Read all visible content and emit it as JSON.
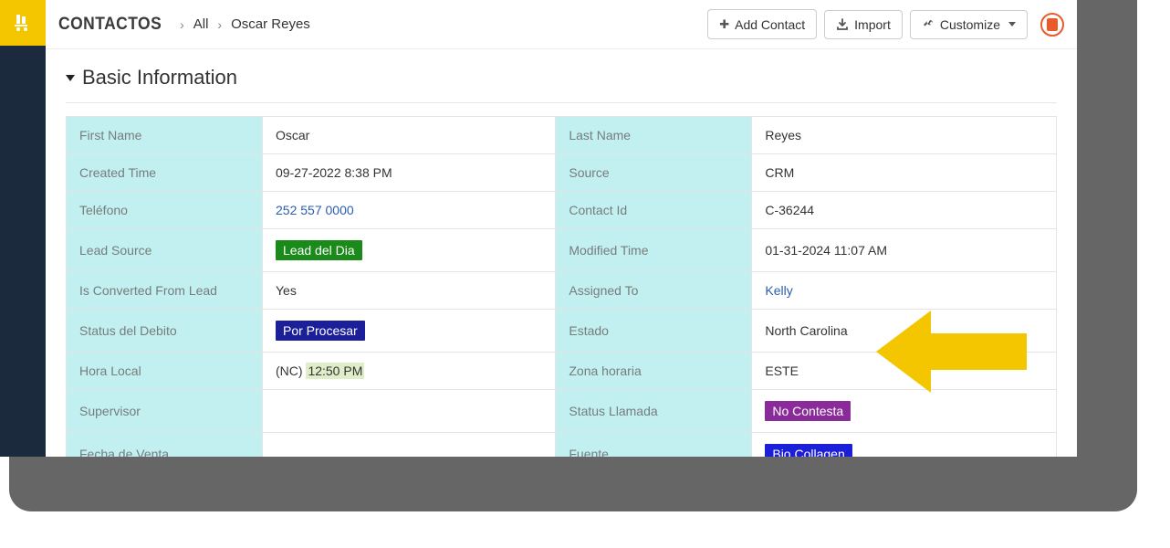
{
  "header": {
    "brand": "CONTACTOS",
    "crumb_all": "All",
    "crumb_current": "Oscar Reyes",
    "add_contact": "Add Contact",
    "import": "Import",
    "customize": "Customize"
  },
  "section": {
    "title": "Basic Information"
  },
  "fields": {
    "first_name_label": "First Name",
    "first_name": "Oscar",
    "last_name_label": "Last Name",
    "last_name": "Reyes",
    "created_time_label": "Created Time",
    "created_time": "09-27-2022 8:38 PM",
    "source_label": "Source",
    "source": "CRM",
    "telefono_label": "Teléfono",
    "telefono": "252 557 0000",
    "contact_id_label": "Contact Id",
    "contact_id": "C-36244",
    "lead_source_label": "Lead Source",
    "lead_source_tag": "Lead del Dia",
    "modified_time_label": "Modified Time",
    "modified_time": "01-31-2024 11:07 AM",
    "is_converted_label": "Is Converted From Lead",
    "is_converted": "Yes",
    "assigned_to_label": "Assigned To",
    "assigned_to": "Kelly",
    "status_debito_label": "Status del Debito",
    "status_debito_tag": "Por Procesar",
    "estado_label": "Estado",
    "estado": "North Carolina",
    "hora_local_label": "Hora Local",
    "hora_local_prefix": "(NC) ",
    "hora_local_time": "12:50 PM",
    "zona_horaria_label": "Zona horaria",
    "zona_horaria": "ESTE",
    "supervisor_label": "Supervisor",
    "supervisor": "",
    "status_llamada_label": "Status Llamada",
    "status_llamada_tag": "No Contesta",
    "fecha_venta_label": "Fecha de Venta",
    "fecha_venta": "",
    "fuente_label": "Fuente",
    "fuente_tag": "Bio Collagen"
  },
  "colors": {
    "accent_cyan": "#c2f0f0",
    "tag_green": "#1a8a1a",
    "tag_navy": "#1c1f9a",
    "tag_purple": "#8a2b9a",
    "tag_blue": "#1c1fd8",
    "arrow": "#f3c600"
  }
}
